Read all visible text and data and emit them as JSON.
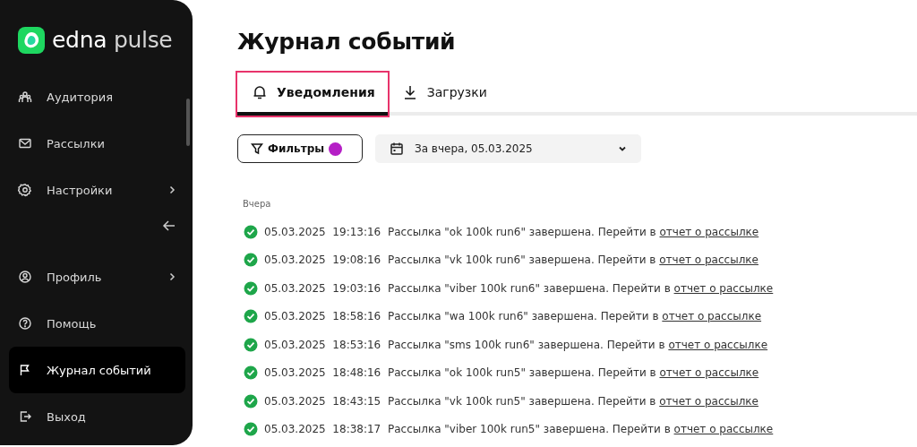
{
  "sidebar": {
    "logo": {
      "name": "edna",
      "suffix": "pulse"
    },
    "items": [
      {
        "label": "Аудитория",
        "has_submenu": false,
        "selected": false
      },
      {
        "label": "Рассылки",
        "has_submenu": false,
        "selected": false
      },
      {
        "label": "Настройки",
        "has_submenu": true,
        "selected": false
      }
    ],
    "bottom_items": [
      {
        "label": "Профиль",
        "has_submenu": true,
        "selected": false
      },
      {
        "label": "Помощь",
        "has_submenu": false,
        "selected": false
      },
      {
        "label": "Журнал событий",
        "has_submenu": false,
        "selected": true
      },
      {
        "label": "Выход",
        "has_submenu": false,
        "selected": false
      }
    ]
  },
  "page_title": "Журнал событий",
  "tabs": [
    {
      "label": "Уведомления",
      "selected": true,
      "highlighted": true
    },
    {
      "label": "Загрузки",
      "selected": false,
      "highlighted": false
    }
  ],
  "filters": {
    "label": "Фильтры",
    "active": true
  },
  "period": {
    "value": "За вчера, 05.03.2025"
  },
  "group_label": "Вчера",
  "events": [
    {
      "date": "05.03.2025",
      "time": "19:13:16",
      "message": "Рассылка \"ok 100k run6\" завершена. Перейти в",
      "link": "отчет о рассылке"
    },
    {
      "date": "05.03.2025",
      "time": "19:08:16",
      "message": "Рассылка \"vk 100k run6\" завершена. Перейти в",
      "link": "отчет о рассылке"
    },
    {
      "date": "05.03.2025",
      "time": "19:03:16",
      "message": "Рассылка \"viber 100k run6\" завершена. Перейти в",
      "link": "отчет о рассылке"
    },
    {
      "date": "05.03.2025",
      "time": "18:58:16",
      "message": "Рассылка \"wa 100k run6\" завершена. Перейти в",
      "link": "отчет о рассылке"
    },
    {
      "date": "05.03.2025",
      "time": "18:53:16",
      "message": "Рассылка \"sms 100k run6\" завершена. Перейти в",
      "link": "отчет о рассылке"
    },
    {
      "date": "05.03.2025",
      "time": "18:48:16",
      "message": "Рассылка \"ok 100k run5\" завершена. Перейти в",
      "link": "отчет о рассылке"
    },
    {
      "date": "05.03.2025",
      "time": "18:43:15",
      "message": "Рассылка \"vk 100k run5\" завершена. Перейти в",
      "link": "отчет о рассылке"
    },
    {
      "date": "05.03.2025",
      "time": "18:38:17",
      "message": "Рассылка \"viber 100k run5\" завершена. Перейти в",
      "link": "отчет о рассылке"
    }
  ]
}
